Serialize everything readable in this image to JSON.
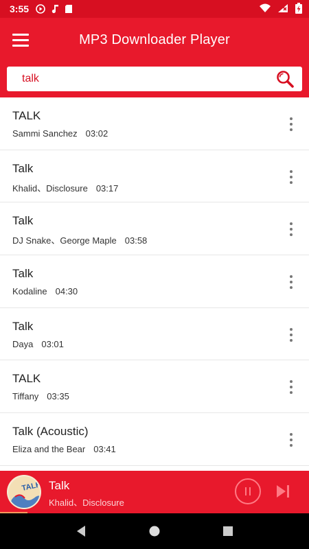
{
  "status_bar": {
    "time": "3:55",
    "icons": [
      "play-circle-icon",
      "music-note-icon",
      "sd-card-icon",
      "wifi-icon",
      "signal-no-data-icon",
      "battery-charging-icon"
    ]
  },
  "app_bar": {
    "title": "MP3 Downloader Player",
    "menu_icon": "hamburger-menu-icon"
  },
  "search": {
    "value": "talk",
    "icon": "search-icon"
  },
  "songs": [
    {
      "title": "TALK",
      "artist": "Sammi Sanchez",
      "duration": "03:02"
    },
    {
      "title": "Talk",
      "artist": "Khalid、Disclosure",
      "duration": "03:17"
    },
    {
      "title": "Talk",
      "artist": "DJ Snake、George Maple",
      "duration": "03:58"
    },
    {
      "title": "Talk",
      "artist": "Kodaline",
      "duration": "04:30"
    },
    {
      "title": "Talk",
      "artist": "Daya",
      "duration": "03:01"
    },
    {
      "title": "TALK",
      "artist": "Tiffany",
      "duration": "03:35"
    },
    {
      "title": "Talk (Acoustic)",
      "artist": "Eliza and the Bear",
      "duration": "03:41"
    }
  ],
  "player": {
    "title": "Talk",
    "artist": "Khalid、Disclosure",
    "art_label": "TALK",
    "state_icon": "pause-icon",
    "next_icon": "skip-next-icon"
  },
  "colors": {
    "primary": "#e8192c",
    "status_bar": "#d70f21",
    "accent_icon": "#ff7a84",
    "nav_bar": "#000000"
  }
}
